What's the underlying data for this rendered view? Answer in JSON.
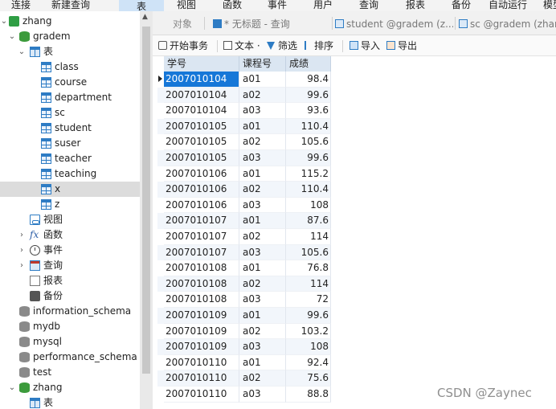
{
  "menu": {
    "items": [
      "连接",
      "新建查询",
      "表",
      "视图",
      "函数",
      "事件",
      "用户",
      "查询",
      "报表",
      "备份",
      "自动运行",
      "模型"
    ],
    "active": "表"
  },
  "tree": {
    "connection": "zhang",
    "database": "gradem",
    "tables_label": "表",
    "tables": [
      "class",
      "course",
      "department",
      "sc",
      "student",
      "suser",
      "teacher",
      "teaching",
      "x",
      "z"
    ],
    "selected_table": "x",
    "views_label": "视图",
    "functions_label": "函数",
    "events_label": "事件",
    "queries_label": "查询",
    "reports_label": "报表",
    "backups_label": "备份",
    "other_databases": [
      "information_schema",
      "mydb",
      "mysql",
      "performance_schema",
      "test"
    ],
    "second_database": "zhang",
    "second_tables_label": "表"
  },
  "tabs": {
    "objects": "对象",
    "query": "* 无标题 - 查询",
    "student": "student @gradem (z...",
    "sc": "sc @gradem (zhan"
  },
  "toolbar": {
    "begin_transaction": "开始事务",
    "text": "文本 ·",
    "filter": "筛选",
    "sort": "排序",
    "import": "导入",
    "export": "导出"
  },
  "grid": {
    "columns": [
      "学号",
      "课程号",
      "成绩"
    ],
    "current_row": 0,
    "rows": [
      [
        "2007010104",
        "a01",
        "98.4"
      ],
      [
        "2007010104",
        "a02",
        "99.6"
      ],
      [
        "2007010104",
        "a03",
        "93.6"
      ],
      [
        "2007010105",
        "a01",
        "110.4"
      ],
      [
        "2007010105",
        "a02",
        "105.6"
      ],
      [
        "2007010105",
        "a03",
        "99.6"
      ],
      [
        "2007010106",
        "a01",
        "115.2"
      ],
      [
        "2007010106",
        "a02",
        "110.4"
      ],
      [
        "2007010106",
        "a03",
        "108"
      ],
      [
        "2007010107",
        "a01",
        "87.6"
      ],
      [
        "2007010107",
        "a02",
        "114"
      ],
      [
        "2007010107",
        "a03",
        "105.6"
      ],
      [
        "2007010108",
        "a01",
        "76.8"
      ],
      [
        "2007010108",
        "a02",
        "114"
      ],
      [
        "2007010108",
        "a03",
        "72"
      ],
      [
        "2007010109",
        "a01",
        "99.6"
      ],
      [
        "2007010109",
        "a02",
        "103.2"
      ],
      [
        "2007010109",
        "a03",
        "108"
      ],
      [
        "2007010110",
        "a01",
        "92.4"
      ],
      [
        "2007010110",
        "a02",
        "75.6"
      ],
      [
        "2007010110",
        "a03",
        "88.8"
      ]
    ]
  },
  "watermark": "CSDN @Zaynec",
  "colors": {
    "selection": "#1677d8",
    "header": "#dbe6f2",
    "active_menu": "#cfe3f7"
  }
}
